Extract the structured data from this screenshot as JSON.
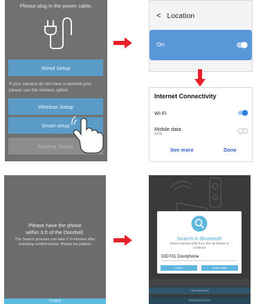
{
  "colors": {
    "arrow": "#e8202a",
    "accent_blue": "#5b9cc6",
    "toggle_on": "#2f7fe0"
  },
  "panel_plug": {
    "hint": "Please plug in the power cable.",
    "wired_label": "Wired Setup",
    "note": "If your camera do not have a network port, please use the wireless option.",
    "wireless_label": "Wireless Setup",
    "smart_label": "Smart setup",
    "existing_label": "Existing Device",
    "icons": [
      "power-plug-icon",
      "hand-pointer-icon"
    ]
  },
  "panel_location": {
    "back_label": "Location",
    "on_label": "On",
    "toggle_on": true
  },
  "panel_connectivity": {
    "title": "Internet Connectivity",
    "wifi_label": "Wi-Fi",
    "wifi_on": true,
    "mobile_label": "Mobile data",
    "mobile_sub": "KPN",
    "mobile_on": false,
    "see_more": "See more",
    "done": "Done"
  },
  "panel_proximity": {
    "line1": "Please have the phone",
    "line2": "within 3 ft of the Doorbell.",
    "detail": "The Search process can take 2-3 minutes after selecting confirm below. Please be patient.",
    "confirm": "Confirm"
  },
  "panel_bluetooth": {
    "title": "Search in Bluetooth",
    "subtitle": "Select camera DID from the list below to continue",
    "device": "DID701 Doorphone",
    "cancel": "Cancel",
    "search_again": "Search Again",
    "bar1": "View Manual",
    "bar2": "Existing Device"
  }
}
